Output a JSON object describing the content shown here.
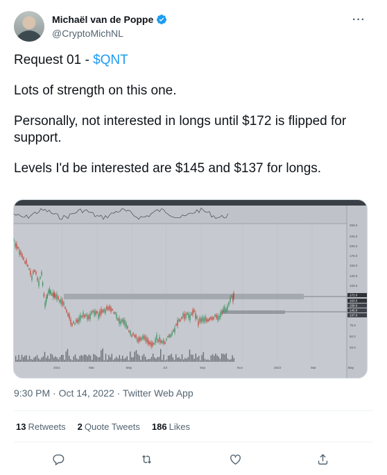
{
  "author": {
    "display_name": "Michaël van de Poppe",
    "handle": "@CryptoMichNL"
  },
  "tweet": {
    "title_prefix": "Request 01 - ",
    "cashtag": "$QNT",
    "paragraphs": [
      "Lots of strength on this one.",
      "Personally, not interested in longs until $172 is flipped for support.",
      "Levels I'd be interested are $145 and $137 for longs."
    ]
  },
  "meta": {
    "timestamp": "9:30 PM · Oct 14, 2022 · Twitter Web App"
  },
  "stats": {
    "retweets_count": "13",
    "retweets_label": "Retweets",
    "quotes_count": "2",
    "quotes_label": "Quote Tweets",
    "likes_count": "186",
    "likes_label": "Likes"
  },
  "icons": {
    "more": "more-icon",
    "reply": "reply-icon",
    "retweet": "retweet-icon",
    "like": "like-icon",
    "share": "share-icon",
    "verified": "verified-badge-icon"
  },
  "colors": {
    "accent": "#1d9bf0",
    "secondary_text": "#536471",
    "chart_bg": "#c5c9cf"
  },
  "chart": {
    "x_ticks": [
      "2021",
      "Mar",
      "May",
      "Jul",
      "Sep",
      "Nov",
      "2023",
      "Mar",
      "May"
    ],
    "y_ticks": [
      "250.0",
      "225.0",
      "200.0",
      "175.0",
      "150.0",
      "125.0",
      "100.0",
      "75.0",
      "50.0",
      "25.0"
    ],
    "level_labels": [
      "172.0",
      "163.0",
      "158.0",
      "145.0",
      "137.0"
    ]
  }
}
